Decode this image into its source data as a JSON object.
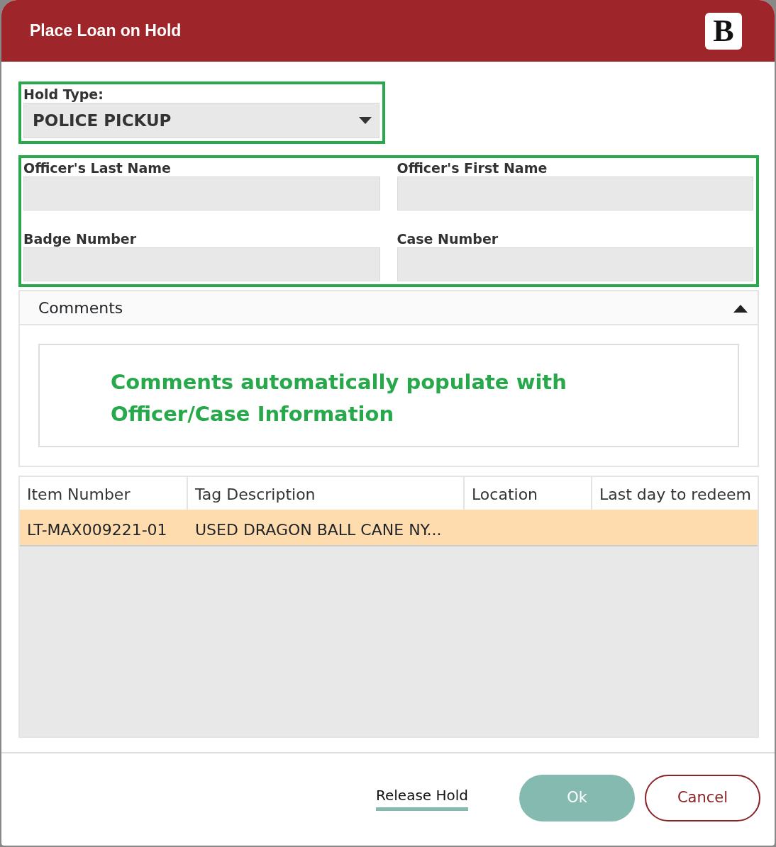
{
  "window": {
    "title": "Place Loan on Hold",
    "logo": "B"
  },
  "hold_type": {
    "label": "Hold Type:",
    "value": "POLICE PICKUP"
  },
  "officer_fields": [
    {
      "label": "Officer's Last Name"
    },
    {
      "label": "Officer's First Name"
    },
    {
      "label": "Badge Number"
    },
    {
      "label": "Case Number"
    }
  ],
  "comments": {
    "title": "Comments",
    "expanded": true,
    "note": "Comments automatically populate with Officer/Case Information"
  },
  "table": {
    "columns": [
      "Item Number",
      "Tag Description",
      "Location",
      "Last day to redeem"
    ],
    "rows": [
      {
        "cells": [
          "LT-MAX009221-01",
          "USED DRAGON BALL CANE NY..."
        ],
        "selected": true
      }
    ]
  },
  "footer": {
    "link": "Release Hold",
    "buttons": [
      {
        "label": "Ok",
        "kind": "primary"
      },
      {
        "label": "Cancel",
        "kind": "secondary"
      }
    ]
  }
}
